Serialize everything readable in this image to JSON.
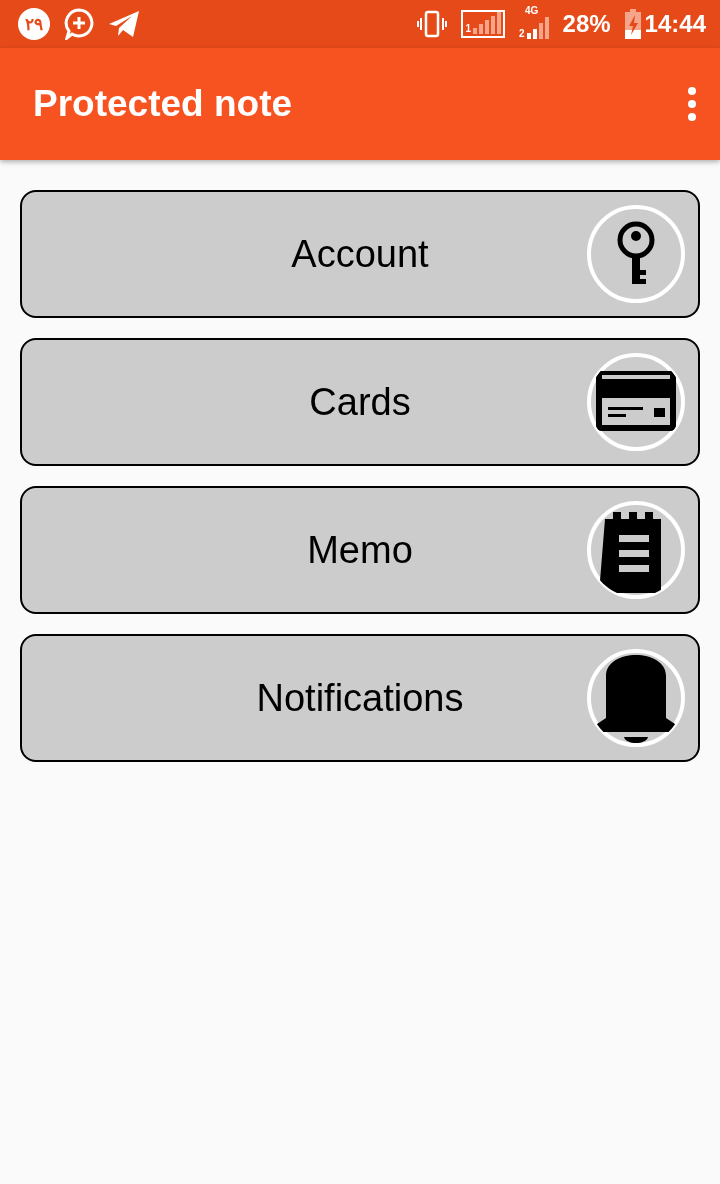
{
  "status_bar": {
    "date_badge": "۲۹",
    "network": "4G",
    "sim_1": "1",
    "sim_2": "2",
    "battery": "28%",
    "time": "14:44"
  },
  "app_bar": {
    "title": "Protected note"
  },
  "items": [
    {
      "label": "Account",
      "kind": "key"
    },
    {
      "label": "Cards",
      "kind": "card"
    },
    {
      "label": "Memo",
      "kind": "memo"
    },
    {
      "label": "Notifications",
      "kind": "bell"
    }
  ]
}
